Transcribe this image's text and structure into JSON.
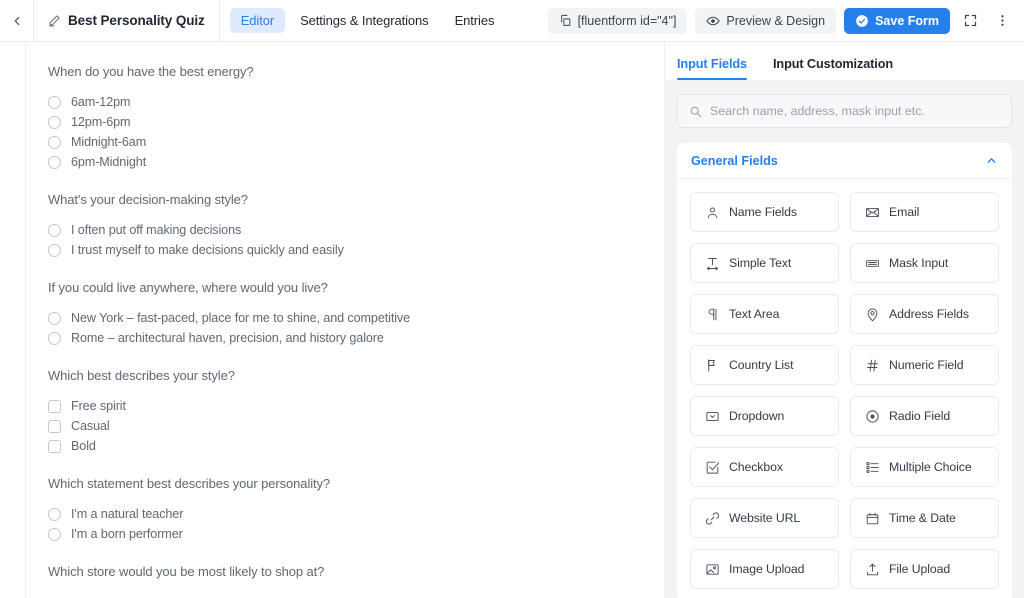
{
  "topbar": {
    "back_icon": "chevron-left-icon",
    "form_title": "Best Personality Quiz",
    "title_icon": "pencil-icon",
    "tabs": [
      {
        "label": "Editor",
        "active": true
      },
      {
        "label": "Settings & Integrations",
        "active": false
      },
      {
        "label": "Entries",
        "active": false
      }
    ],
    "shortcode_chip": {
      "icon": "copy-icon",
      "label": "[fluentform id=\"4\"]"
    },
    "preview_button": {
      "icon": "eye-icon",
      "label": "Preview & Design"
    },
    "save_button": {
      "icon": "check-circle-icon",
      "label": "Save Form"
    },
    "expand_icon": "fullscreen-icon",
    "more_icon": "more-vertical-icon"
  },
  "canvas": {
    "questions": [
      {
        "label": "When do you have the best energy?",
        "type": "radio",
        "options": [
          "6am-12pm",
          "12pm-6pm",
          "Midnight-6am",
          "6pm-Midnight"
        ]
      },
      {
        "label": "What's your decision-making style?",
        "type": "radio",
        "options": [
          "I often put off making decisions",
          "I trust myself to make decisions quickly and easily"
        ]
      },
      {
        "label": "If you could live anywhere, where would you live?",
        "type": "radio",
        "options": [
          "New York – fast-paced, place for me to shine, and competitive",
          "Rome – architectural haven, precision, and history galore"
        ]
      },
      {
        "label": "Which best describes your style?",
        "type": "checkbox",
        "options": [
          "Free spirit",
          "Casual",
          "Bold"
        ]
      },
      {
        "label": "Which statement best describes your personality?",
        "type": "radio",
        "options": [
          "I'm a natural teacher",
          "I'm a born performer"
        ]
      },
      {
        "label": "Which store would you be most likely to shop at?",
        "type": "radio",
        "options": []
      }
    ]
  },
  "panel": {
    "tabs": [
      {
        "label": "Input Fields",
        "active": true
      },
      {
        "label": "Input Customization",
        "active": false
      }
    ],
    "search": {
      "icon": "search-icon",
      "placeholder": "Search name, address, mask input etc.",
      "value": ""
    },
    "group": {
      "title": "General Fields",
      "collapse_icon": "chevron-up-icon",
      "fields": [
        {
          "label": "Name Fields",
          "icon": "user-icon"
        },
        {
          "label": "Email",
          "icon": "envelope-icon"
        },
        {
          "label": "Simple Text",
          "icon": "text-width-icon"
        },
        {
          "label": "Mask Input",
          "icon": "keyboard-icon"
        },
        {
          "label": "Text Area",
          "icon": "paragraph-icon"
        },
        {
          "label": "Address Fields",
          "icon": "map-pin-icon"
        },
        {
          "label": "Country List",
          "icon": "flag-icon"
        },
        {
          "label": "Numeric Field",
          "icon": "hash-icon"
        },
        {
          "label": "Dropdown",
          "icon": "select-caret-icon"
        },
        {
          "label": "Radio Field",
          "icon": "radio-circle-icon"
        },
        {
          "label": "Checkbox",
          "icon": "checkbox-check-icon"
        },
        {
          "label": "Multiple Choice",
          "icon": "list-choice-icon"
        },
        {
          "label": "Website URL",
          "icon": "link-icon"
        },
        {
          "label": "Time & Date",
          "icon": "calendar-icon"
        },
        {
          "label": "Image Upload",
          "icon": "image-icon"
        },
        {
          "label": "File Upload",
          "icon": "upload-icon"
        }
      ]
    }
  },
  "colors": {
    "accent": "#2680ec",
    "accent_soft": "#ddeaff",
    "panel_bg": "#f2f3f5",
    "text": "#1f2733",
    "muted": "#5f6874"
  }
}
